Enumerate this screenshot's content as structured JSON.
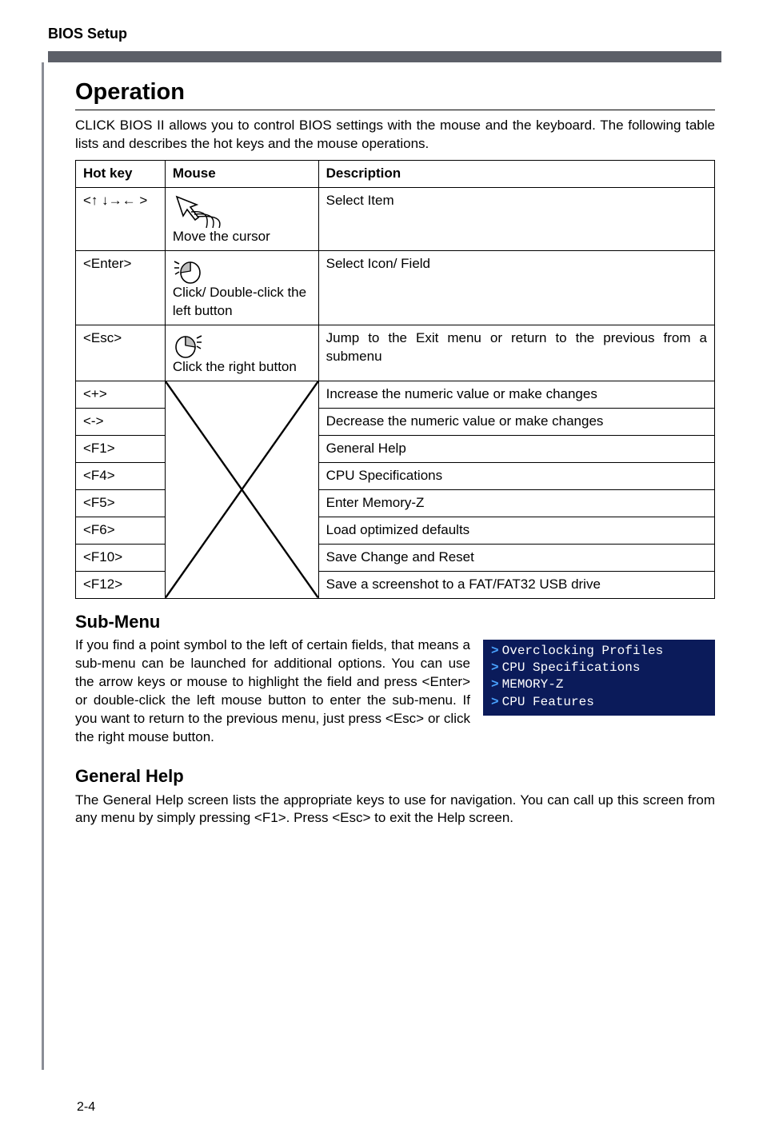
{
  "page_header": "BIOS Setup",
  "op_heading": "Operation",
  "op_intro": "CLICK BIOS II allows you to control BIOS settings with the mouse and the keyboard. The following table lists and describes the hot keys and the mouse operations.",
  "table": {
    "head": {
      "hk": "Hot key",
      "ms": "Mouse",
      "ds": "Description"
    },
    "r1": {
      "hk": "<↑ ↓→← >",
      "ms": "Move the cursor",
      "ds": "Select Item"
    },
    "r2": {
      "hk": "<Enter>",
      "ms": "Click/ Double-click the left button",
      "ds": "Select  Icon/ Field"
    },
    "r3": {
      "hk": "<Esc>",
      "ms": "Click the right button",
      "ds": "Jump to the Exit menu or return to the previous from a submenu"
    },
    "r4": {
      "hk": "<+>",
      "ds": "Increase the numeric value or make changes"
    },
    "r5": {
      "hk": "<->",
      "ds": "Decrease the numeric value or make changes"
    },
    "r6": {
      "hk": "<F1>",
      "ds": "General Help"
    },
    "r7": {
      "hk": "<F4>",
      "ds": "CPU Specifications"
    },
    "r8": {
      "hk": "<F5>",
      "ds": "Enter Memory-Z"
    },
    "r9": {
      "hk": "<F6>",
      "ds": "Load optimized defaults"
    },
    "r10": {
      "hk": "<F10>",
      "ds": "Save Change and Reset"
    },
    "r11": {
      "hk": "<F12>",
      "ds": "Save a screenshot to a FAT/FAT32 USB drive"
    }
  },
  "sub_heading": "Sub-Menu",
  "sub_text": "If you find a point symbol to the left of certain fields, that means a sub-menu can be launched for additional options. You can use the arrow keys or mouse to highlight the field and press <Enter> or double-click the left mouse button to enter the sub-menu. If you want to return to the previous menu, just press <Esc> or click the right mouse button.",
  "sub_items": {
    "a": "Overclocking Profiles",
    "b": "CPU Specifications",
    "c": "MEMORY-Z",
    "d": "CPU Features"
  },
  "gh_heading": "General Help",
  "gh_text": "The General Help screen lists the appropriate keys to use for navigation. You can call up this screen from any menu by simply pressing <F1>. Press <Esc> to exit the Help screen.",
  "page_number": "2-4"
}
